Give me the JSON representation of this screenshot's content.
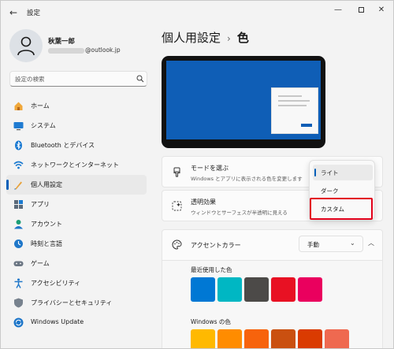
{
  "app": {
    "title": "設定"
  },
  "window_controls": {
    "minimize": "—",
    "close": "✕"
  },
  "user": {
    "name": "秋葉一郎",
    "email_suffix": "@outlook.jp"
  },
  "search": {
    "placeholder": "設定の検索"
  },
  "sidebar": {
    "items": [
      {
        "label": "ホーム",
        "icon": "home-icon"
      },
      {
        "label": "システム",
        "icon": "system-icon"
      },
      {
        "label": "Bluetooth とデバイス",
        "icon": "bluetooth-icon"
      },
      {
        "label": "ネットワークとインターネット",
        "icon": "network-icon"
      },
      {
        "label": "個人用設定",
        "icon": "personalization-icon",
        "active": true
      },
      {
        "label": "アプリ",
        "icon": "apps-icon"
      },
      {
        "label": "アカウント",
        "icon": "account-icon"
      },
      {
        "label": "時刻と言語",
        "icon": "time-language-icon"
      },
      {
        "label": "ゲーム",
        "icon": "gaming-icon"
      },
      {
        "label": "アクセシビリティ",
        "icon": "accessibility-icon"
      },
      {
        "label": "プライバシーとセキュリティ",
        "icon": "privacy-icon"
      },
      {
        "label": "Windows Update",
        "icon": "windows-update-icon"
      }
    ]
  },
  "breadcrumb": {
    "parent": "個人用設定",
    "separator": "›",
    "current": "色"
  },
  "mode": {
    "title": "モードを選ぶ",
    "subtitle": "Windows とアプリに表示される色を変更します"
  },
  "transparency": {
    "title": "透明効果",
    "subtitle": "ウィンドウとサーフェスが半透明に見える"
  },
  "accent": {
    "title": "アクセントカラー",
    "select_value": "手動",
    "recent_label": "最近使用した色",
    "windows_label": "Windows の色",
    "recent_colors": [
      "#0078d4",
      "#00b7c3",
      "#4c4a48",
      "#e81123",
      "#ea005e"
    ],
    "windows_colors": [
      "#ffb900",
      "#ff8c00",
      "#f7630c",
      "#ca5010",
      "#da3b01",
      "#ef6950"
    ]
  },
  "mode_dropdown": {
    "options": [
      "ライト",
      "ダーク",
      "カスタム"
    ],
    "selected": "ライト",
    "highlighted": "カスタム"
  },
  "colors": {
    "accent": "#005fb8",
    "highlight": "#e2001a",
    "preview_desktop": "#0f5eb6"
  }
}
